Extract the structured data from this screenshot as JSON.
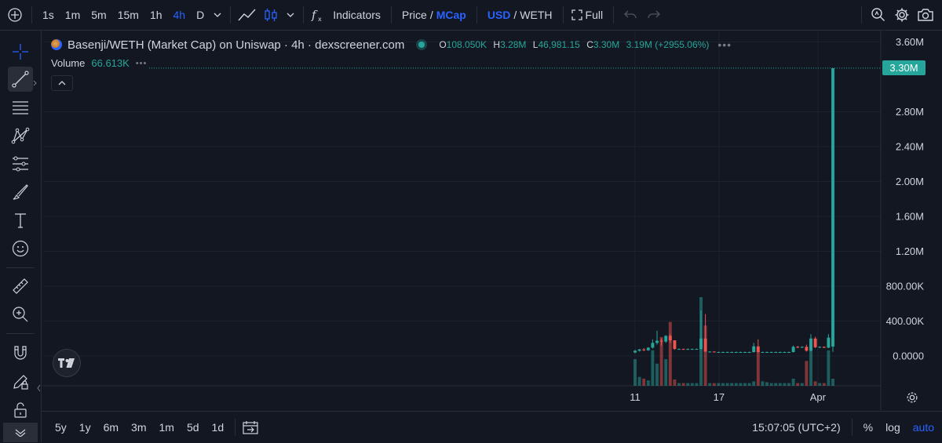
{
  "toolbar": {
    "intervals": [
      "1s",
      "1m",
      "5m",
      "15m",
      "1h",
      "4h",
      "D"
    ],
    "active_interval": "4h",
    "indicators_label": "Indicators",
    "price_label": "Price",
    "mcap_label": "MCap",
    "usd_label": "USD",
    "weth_label": "WETH",
    "full_label": "Full"
  },
  "legend": {
    "title": "Basenji/WETH (Market Cap) on Uniswap · 4h · dexscreener.com",
    "open_key": "O",
    "open": "108.050K",
    "high_key": "H",
    "high": "3.28M",
    "low_key": "L",
    "low": "46,981.15",
    "close_key": "C",
    "close": "3.30M",
    "change": "3.19M (+2955.06%)",
    "volume_label": "Volume",
    "volume_value": "66.613K"
  },
  "bottombar": {
    "ranges": [
      "5y",
      "1y",
      "6m",
      "3m",
      "1m",
      "5d",
      "1d"
    ],
    "time": "15:07:05 (UTC+2)",
    "percent": "%",
    "log": "log",
    "auto": "auto"
  },
  "colors": {
    "up": "#26a69a",
    "down": "#ef5350",
    "accent": "#2962ff"
  },
  "chart_data": {
    "type": "candlestick",
    "y_ticks": [
      "3.60M",
      "2.80M",
      "2.40M",
      "2.00M",
      "1.60M",
      "1.20M",
      "800.00K",
      "400.00K",
      "0.0000"
    ],
    "y_tick_values": [
      3600000,
      2800000,
      2400000,
      2000000,
      1600000,
      1200000,
      800000,
      400000,
      0
    ],
    "ylim": [
      -260000,
      3600000
    ],
    "last_price_label": "3.30M",
    "last_price": 3300000,
    "x_ticks": [
      {
        "label": "11",
        "pos": 0.0
      },
      {
        "label": "17",
        "pos": 0.424
      },
      {
        "label": "Apr",
        "pos": 0.924
      }
    ],
    "candles": [
      {
        "o": 40000,
        "h": 70000,
        "l": 30000,
        "c": 60000,
        "v": 0.3
      },
      {
        "o": 60000,
        "h": 80000,
        "l": 50000,
        "c": 75000,
        "v": 0.1
      },
      {
        "o": 75000,
        "h": 90000,
        "l": 55000,
        "c": 65000,
        "v": 0.08
      },
      {
        "o": 65000,
        "h": 100000,
        "l": 60000,
        "c": 95000,
        "v": 0.06
      },
      {
        "o": 95000,
        "h": 190000,
        "l": 85000,
        "c": 150000,
        "v": 0.4
      },
      {
        "o": 150000,
        "h": 290000,
        "l": 130000,
        "c": 175000,
        "v": 0.25
      },
      {
        "o": 175000,
        "h": 200000,
        "l": 120000,
        "c": 165000,
        "v": 0.55
      },
      {
        "o": 165000,
        "h": 240000,
        "l": 150000,
        "c": 230000,
        "v": 0.3
      },
      {
        "o": 230000,
        "h": 250000,
        "l": 150000,
        "c": 180000,
        "v": 0.72
      },
      {
        "o": 180000,
        "h": 180000,
        "l": 70000,
        "c": 80000,
        "v": 0.07
      },
      {
        "o": 80000,
        "h": 85000,
        "l": 75000,
        "c": 80000,
        "v": 0.03
      },
      {
        "o": 80000,
        "h": 85000,
        "l": 70000,
        "c": 75000,
        "v": 0.03
      },
      {
        "o": 75000,
        "h": 85000,
        "l": 70000,
        "c": 80000,
        "v": 0.03
      },
      {
        "o": 80000,
        "h": 85000,
        "l": 75000,
        "c": 80000,
        "v": 0.03
      },
      {
        "o": 80000,
        "h": 85000,
        "l": 75000,
        "c": 80000,
        "v": 0.03
      },
      {
        "o": 80000,
        "h": 520000,
        "l": 70000,
        "c": 200000,
        "v": 1.0
      },
      {
        "o": 200000,
        "h": 480000,
        "l": 50000,
        "c": 50000,
        "v": 0.68
      },
      {
        "o": 50000,
        "h": 55000,
        "l": 40000,
        "c": 50000,
        "v": 0.03
      },
      {
        "o": 50000,
        "h": 55000,
        "l": 40000,
        "c": 45000,
        "v": 0.03
      },
      {
        "o": 45000,
        "h": 50000,
        "l": 40000,
        "c": 45000,
        "v": 0.03
      },
      {
        "o": 45000,
        "h": 50000,
        "l": 40000,
        "c": 45000,
        "v": 0.03
      },
      {
        "o": 45000,
        "h": 50000,
        "l": 40000,
        "c": 45000,
        "v": 0.03
      },
      {
        "o": 45000,
        "h": 50000,
        "l": 40000,
        "c": 45000,
        "v": 0.03
      },
      {
        "o": 45000,
        "h": 50000,
        "l": 40000,
        "c": 45000,
        "v": 0.03
      },
      {
        "o": 45000,
        "h": 50000,
        "l": 40000,
        "c": 45000,
        "v": 0.03
      },
      {
        "o": 45000,
        "h": 50000,
        "l": 40000,
        "c": 45000,
        "v": 0.03
      },
      {
        "o": 45000,
        "h": 50000,
        "l": 40000,
        "c": 45000,
        "v": 0.03
      },
      {
        "o": 45000,
        "h": 150000,
        "l": 40000,
        "c": 110000,
        "v": 0.05
      },
      {
        "o": 110000,
        "h": 190000,
        "l": 40000,
        "c": 45000,
        "v": 0.4
      },
      {
        "o": 45000,
        "h": 50000,
        "l": 40000,
        "c": 45000,
        "v": 0.05
      },
      {
        "o": 45000,
        "h": 50000,
        "l": 40000,
        "c": 45000,
        "v": 0.04
      },
      {
        "o": 45000,
        "h": 50000,
        "l": 40000,
        "c": 45000,
        "v": 0.03
      },
      {
        "o": 45000,
        "h": 50000,
        "l": 40000,
        "c": 45000,
        "v": 0.03
      },
      {
        "o": 45000,
        "h": 50000,
        "l": 40000,
        "c": 45000,
        "v": 0.03
      },
      {
        "o": 45000,
        "h": 50000,
        "l": 40000,
        "c": 45000,
        "v": 0.03
      },
      {
        "o": 45000,
        "h": 50000,
        "l": 40000,
        "c": 45000,
        "v": 0.03
      },
      {
        "o": 45000,
        "h": 120000,
        "l": 40000,
        "c": 105000,
        "v": 0.08
      },
      {
        "o": 105000,
        "h": 115000,
        "l": 90000,
        "c": 100000,
        "v": 0.03
      },
      {
        "o": 100000,
        "h": 110000,
        "l": 90000,
        "c": 105000,
        "v": 0.03
      },
      {
        "o": 105000,
        "h": 130000,
        "l": 50000,
        "c": 60000,
        "v": 0.28
      },
      {
        "o": 60000,
        "h": 250000,
        "l": 55000,
        "c": 200000,
        "v": 0.4
      },
      {
        "o": 200000,
        "h": 220000,
        "l": 90000,
        "c": 100000,
        "v": 0.05
      },
      {
        "o": 100000,
        "h": 110000,
        "l": 90000,
        "c": 105000,
        "v": 0.03
      },
      {
        "o": 105000,
        "h": 110000,
        "l": 90000,
        "c": 95000,
        "v": 0.03
      },
      {
        "o": 95000,
        "h": 250000,
        "l": 90000,
        "c": 210000,
        "v": 0.4
      },
      {
        "o": 108050,
        "h": 3280000,
        "l": 46981,
        "c": 3300000,
        "v": 0.08
      }
    ]
  }
}
